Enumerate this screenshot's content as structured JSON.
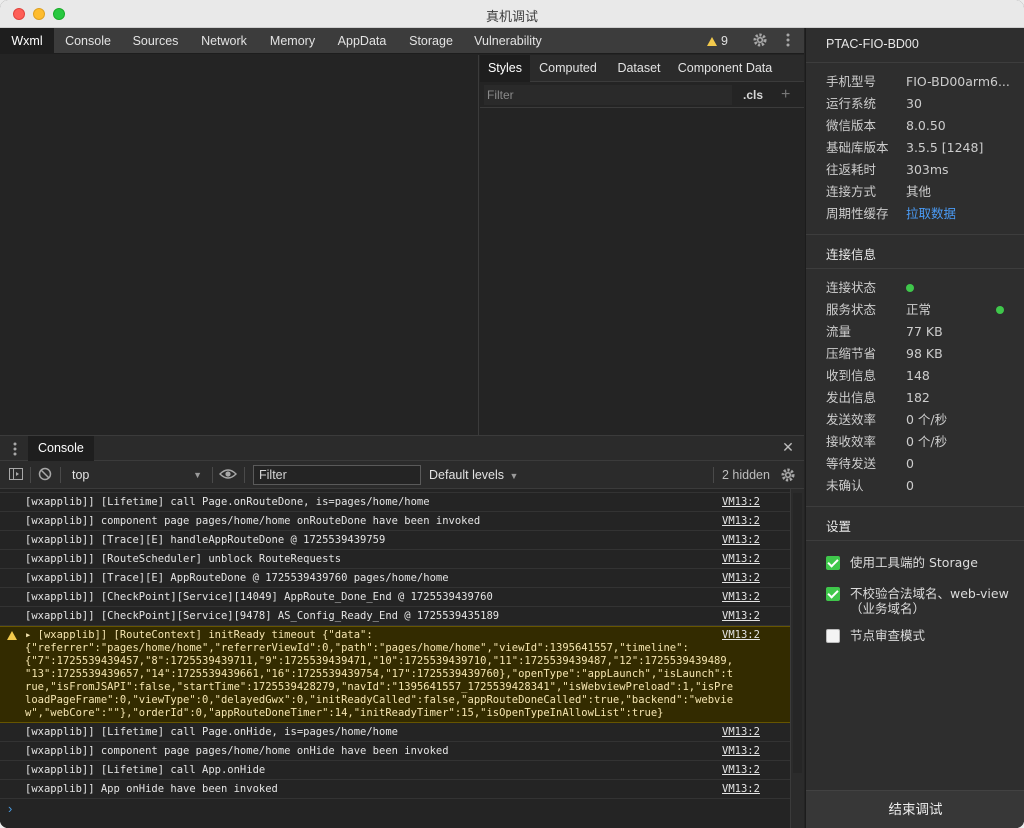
{
  "window": {
    "title": "真机调试"
  },
  "toolbar": {
    "tabs": [
      "Wxml",
      "Console",
      "Sources",
      "Network",
      "Memory",
      "AppData",
      "Storage",
      "Vulnerability"
    ],
    "active_tab": "Wxml",
    "warning_count": "9"
  },
  "styles_pane": {
    "tabs": [
      "Styles",
      "Computed",
      "Dataset",
      "Component Data"
    ],
    "filter_placeholder": "Filter",
    "cls_label": ".cls",
    "add_label": "+"
  },
  "drawer": {
    "tab_label": "Console",
    "close_glyph": "✕"
  },
  "console": {
    "context": "top",
    "filter_value": "Filter",
    "levels_label": "Default levels",
    "hidden_label": "2 hidden",
    "prompt": "›",
    "logs": [
      {
        "msg": "[wxapplib]] [Lifetime] call Page.onRouteDone, is=pages/home/home",
        "src": "VM13:2"
      },
      {
        "msg": "[wxapplib]] component page pages/home/home onRouteDone have been invoked",
        "src": "VM13:2"
      },
      {
        "msg": "[wxapplib]] [Trace][E] handleAppRouteDone @ 1725539439759",
        "src": "VM13:2"
      },
      {
        "msg": "[wxapplib]] [RouteScheduler] unblock RouteRequests",
        "src": "VM13:2"
      },
      {
        "msg": "[wxapplib]] [Trace][E] AppRouteDone @ 1725539439760 pages/home/home",
        "src": "VM13:2"
      },
      {
        "msg": "[wxapplib]] [CheckPoint][Service][14049] AppRoute_Done_End @ 1725539439760",
        "src": "VM13:2"
      },
      {
        "msg": "[wxapplib]] [CheckPoint][Service][9478] AS_Config_Ready_End @ 1725539435189",
        "src": "VM13:2"
      }
    ],
    "warning_log": {
      "msg": "▸ [wxapplib]] [RouteContext] initReady timeout {\"data\":\n{\"referrer\":\"pages/home/home\",\"referrerViewId\":0,\"path\":\"pages/home/home\",\"viewId\":1395641557,\"timeline\":\n{\"7\":1725539439457,\"8\":1725539439711,\"9\":1725539439471,\"10\":1725539439710,\"11\":1725539439487,\"12\":1725539439489,\n\"13\":1725539439657,\"14\":1725539439661,\"16\":1725539439754,\"17\":1725539439760},\"openType\":\"appLaunch\",\"isLaunch\":t\nrue,\"isFromJSAPI\":false,\"startTime\":1725539428279,\"navId\":\"1395641557_1725539428341\",\"isWebviewPreload\":1,\"isPre\nloadPageFrame\":0,\"viewType\":0,\"delayedGwx\":0,\"initReadyCalled\":false,\"appRouteDoneCalled\":true,\"backend\":\"webvie\nw\",\"webCore\":\"\"},\"orderId\":0,\"appRouteDoneTimer\":14,\"initReadyTimer\":15,\"isOpenTypeInAllowList\":true}",
      "src": "VM13:2"
    },
    "logs_after": [
      {
        "msg": "[wxapplib]] [Lifetime] call Page.onHide, is=pages/home/home",
        "src": "VM13:2"
      },
      {
        "msg": "[wxapplib]] component page pages/home/home onHide have been invoked",
        "src": "VM13:2"
      },
      {
        "msg": "[wxapplib]] [Lifetime] call App.onHide",
        "src": "VM13:2"
      },
      {
        "msg": "[wxapplib]] App onHide have been invoked",
        "src": "VM13:2"
      }
    ]
  },
  "side": {
    "device_name": "PTAC-FIO-BD00",
    "device_info": [
      {
        "k": "手机型号",
        "v": "FIO-BD00arm6..."
      },
      {
        "k": "运行系统",
        "v": "30"
      },
      {
        "k": "微信版本",
        "v": "8.0.50"
      },
      {
        "k": "基础库版本",
        "v": "3.5.5 [1248]"
      },
      {
        "k": "往返耗时",
        "v": "303ms"
      },
      {
        "k": "连接方式",
        "v": "其他"
      },
      {
        "k": "周期性缓存",
        "v": "拉取数据"
      }
    ],
    "conn_title": "连接信息",
    "conn_info": [
      {
        "k": "连接状态",
        "v": ""
      },
      {
        "k": "服务状态",
        "v": "正常"
      },
      {
        "k": "流量",
        "v": "77 KB"
      },
      {
        "k": "压缩节省",
        "v": "98 KB"
      },
      {
        "k": "收到信息",
        "v": "148"
      },
      {
        "k": "发出信息",
        "v": "182"
      },
      {
        "k": "发送效率",
        "v": "0 个/秒"
      },
      {
        "k": "接收效率",
        "v": "0 个/秒"
      },
      {
        "k": "等待发送",
        "v": "0"
      },
      {
        "k": "未确认",
        "v": "0"
      }
    ],
    "settings_title": "设置",
    "settings": [
      {
        "label": "使用工具端的 Storage",
        "checked": true
      },
      {
        "label": "不校验合法域名、web-view（业务域名）",
        "checked": true
      },
      {
        "label": "节点审查模式",
        "checked": false
      }
    ],
    "end_button": "结束调试"
  },
  "colors": {
    "accent_link": "#4a9bf5",
    "status_green": "#3fc74b",
    "warning_yellow": "#f2c94c"
  }
}
